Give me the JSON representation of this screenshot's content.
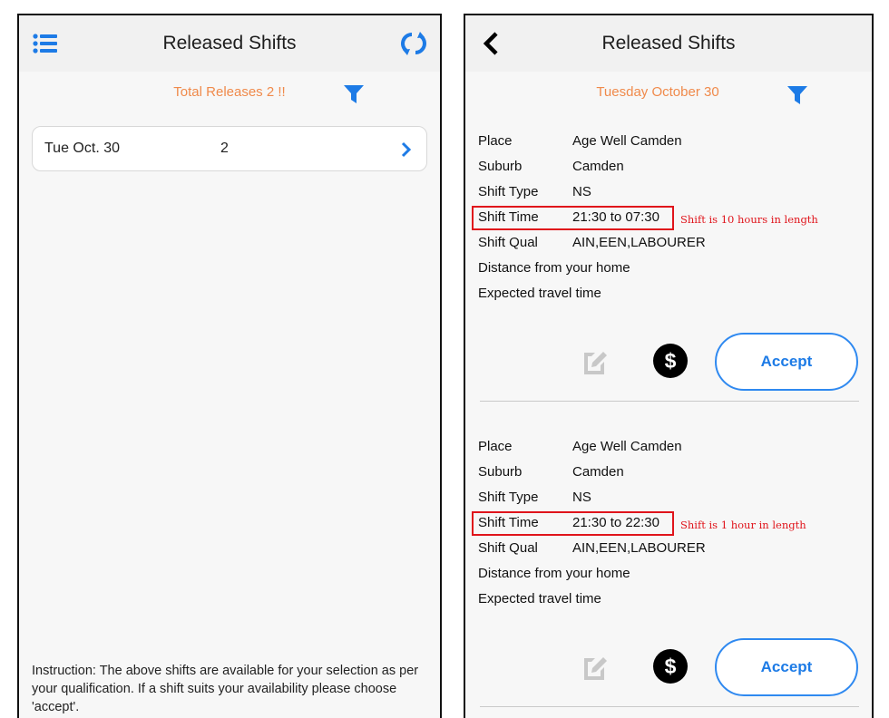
{
  "left_screen": {
    "title": "Released Shifts",
    "menu_icon": "list-icon",
    "refresh_icon": "refresh-icon",
    "total_releases": "Total Releases 2 !!",
    "filter_icon": "filter-icon",
    "date_rows": [
      {
        "date": "Tue Oct. 30",
        "count": "2"
      }
    ],
    "instruction": "Instruction: The above shifts are available for your selection as per your qualification. If a shift suits your availability please choose 'accept'."
  },
  "right_screen": {
    "title": "Released Shifts",
    "back_icon": "chevron-left-icon",
    "date_heading": "Tuesday October 30",
    "filter_icon": "filter-icon",
    "labels": {
      "place": "Place",
      "suburb": "Suburb",
      "shift_type": "Shift Type",
      "shift_time": "Shift Time",
      "shift_qual": "Shift Qual",
      "distance": "Distance from your home",
      "travel": "Expected travel time"
    },
    "shifts": [
      {
        "place": "Age Well Camden",
        "suburb": "Camden",
        "shift_type": "NS",
        "shift_time": "21:30 to 07:30",
        "shift_qual": "AIN,EEN,LABOURER",
        "annotation": "Shift is 10 hours in length",
        "accept_label": "Accept",
        "dollar_label": "$"
      },
      {
        "place": "Age Well Camden",
        "suburb": "Camden",
        "shift_type": "NS",
        "shift_time": "21:30 to 22:30",
        "shift_qual": "AIN,EEN,LABOURER",
        "annotation": "Shift is 1 hour in length",
        "accept_label": "Accept",
        "dollar_label": "$"
      }
    ]
  },
  "colors": {
    "accent_blue": "#1d7be6",
    "orange_text": "#f08a4b",
    "annotation_red": "#e0141b"
  }
}
